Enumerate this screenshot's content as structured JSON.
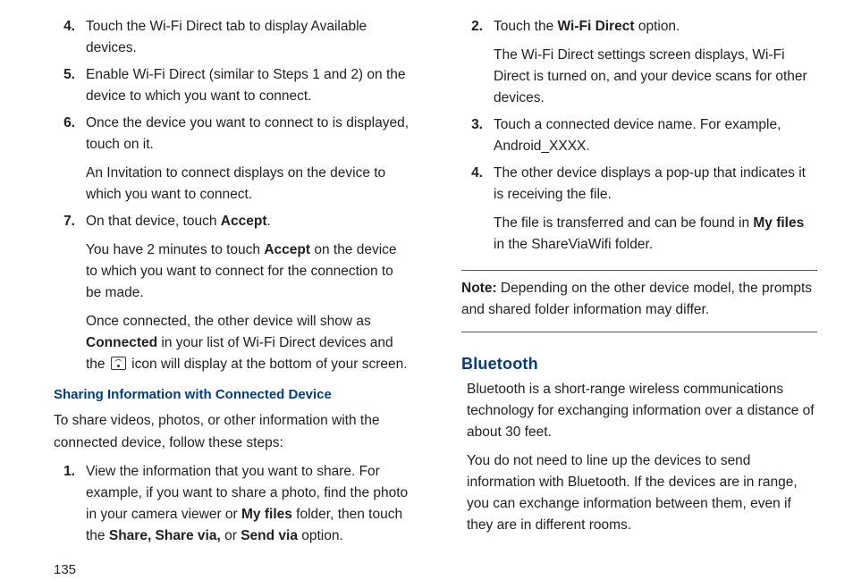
{
  "left": {
    "items": [
      {
        "n": "4.",
        "paras": [
          "Touch the Wi-Fi Direct tab to display Available devices."
        ]
      },
      {
        "n": "5.",
        "paras": [
          "Enable Wi-Fi Direct (similar to Steps 1 and 2) on the device to which you want to connect."
        ]
      },
      {
        "n": "6.",
        "paras": [
          "Once the device you want to connect to is displayed, touch on it.",
          "An Invitation to connect displays on the device to which you want to connect."
        ]
      }
    ],
    "item7": {
      "n": "7.",
      "p1a": "On that device, touch ",
      "p1b": "Accept",
      "p1c": ".",
      "p2a": "You have 2 minutes to touch ",
      "p2b": "Accept",
      "p2c": " on the device to which you want to connect for the connection to be made.",
      "p3a": "Once connected, the other device will show as ",
      "p3b": "Connected",
      "p3c": " in your list of Wi-Fi Direct devices and the ",
      "p3d": " icon will display at the bottom of your screen."
    },
    "subhead": "Sharing Information with Connected Device",
    "intro": "To share videos, photos, or other information with the connected device, follow these steps:",
    "share1": {
      "n": "1.",
      "a": "View the information that you want to share. For example, if you want to share a photo, find the photo in your camera viewer or ",
      "b": "My files",
      "c": " folder, then touch the ",
      "d": "Share, Share via,",
      "e": " or ",
      "f": "Send via",
      "g": " option."
    },
    "pagenum": "135"
  },
  "right": {
    "item2": {
      "n": "2.",
      "a": "Touch the ",
      "b": "Wi-Fi Direct",
      "c": " option.",
      "d": "The Wi-Fi Direct settings screen displays, Wi-Fi Direct is turned on, and your device scans for other devices."
    },
    "item3": {
      "n": "3.",
      "a": "Touch a connected device name. For example, Android_XXXX."
    },
    "item4": {
      "n": "4.",
      "a": "The other device displays a pop-up that indicates it is receiving the file.",
      "b1": "The file is transferred and can be found in ",
      "b2": "My files",
      "b3": " in the ShareViaWifi folder."
    },
    "noteLabel": "Note:",
    "noteBody": "Depending on the other device model, the prompts and shared folder information may differ.",
    "sectionTitle": "Bluetooth",
    "bt1": "Bluetooth is a short-range wireless communications technology for exchanging information over a distance of about 30 feet.",
    "bt2": "You do not need to line up the devices to send information with Bluetooth. If the devices are in range, you can exchange information between them, even if they are in different rooms."
  }
}
